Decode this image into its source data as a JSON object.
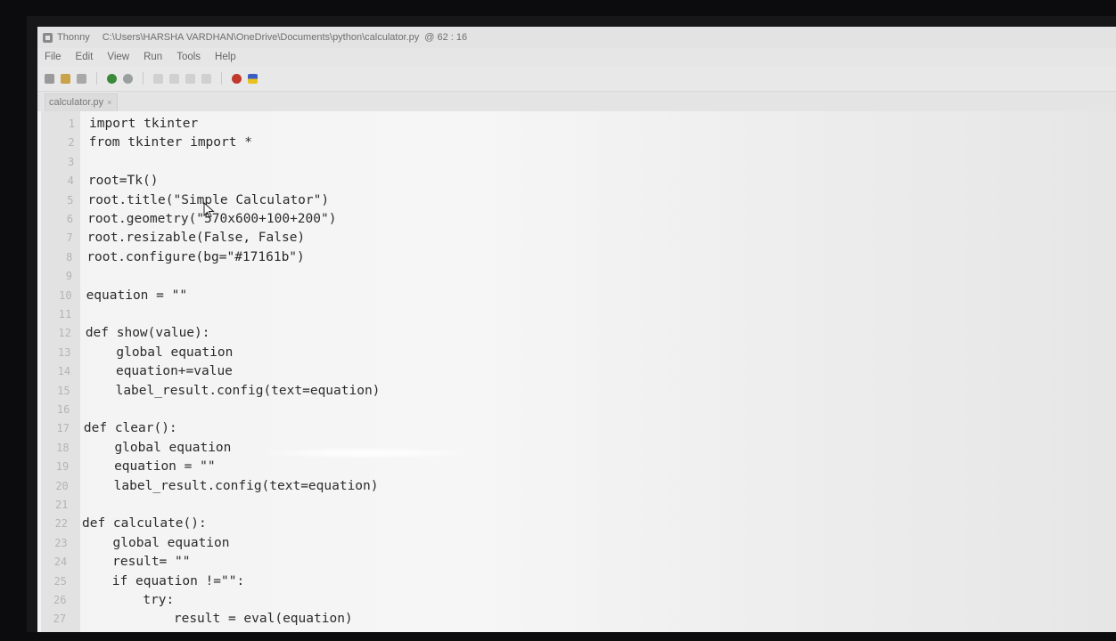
{
  "window": {
    "app_name": "Thonny",
    "file_path": "C:\\Users\\HARSHA VARDHAN\\OneDrive\\Documents\\python\\calculator.py",
    "position": "@ 62 : 16"
  },
  "menu": [
    "File",
    "Edit",
    "View",
    "Run",
    "Tools",
    "Help"
  ],
  "tab": {
    "label": "calculator.py",
    "close": "×"
  },
  "code_lines": [
    {
      "n": "1",
      "text": "import tkinter"
    },
    {
      "n": "2",
      "text": "from tkinter import *"
    },
    {
      "n": "3",
      "text": ""
    },
    {
      "n": "4",
      "text": "root=Tk()"
    },
    {
      "n": "5",
      "text": "root.title(\"Simple Calculator\")"
    },
    {
      "n": "6",
      "text": "root.geometry(\"570x600+100+200\")"
    },
    {
      "n": "7",
      "text": "root.resizable(False, False)"
    },
    {
      "n": "8",
      "text": "root.configure(bg=\"#17161b\")"
    },
    {
      "n": "9",
      "text": ""
    },
    {
      "n": "10",
      "text": "equation = \"\""
    },
    {
      "n": "11",
      "text": ""
    },
    {
      "n": "12",
      "text": "def show(value):"
    },
    {
      "n": "13",
      "text": "    global equation"
    },
    {
      "n": "14",
      "text": "    equation+=value"
    },
    {
      "n": "15",
      "text": "    label_result.config(text=equation)"
    },
    {
      "n": "16",
      "text": ""
    },
    {
      "n": "17",
      "text": "def clear():"
    },
    {
      "n": "18",
      "text": "    global equation"
    },
    {
      "n": "19",
      "text": "    equation = \"\""
    },
    {
      "n": "20",
      "text": "    label_result.config(text=equation)"
    },
    {
      "n": "21",
      "text": ""
    },
    {
      "n": "22",
      "text": "def calculate():"
    },
    {
      "n": "23",
      "text": "    global equation"
    },
    {
      "n": "24",
      "text": "    result= \"\""
    },
    {
      "n": "25",
      "text": "    if equation !=\"\":"
    },
    {
      "n": "26",
      "text": "        try:"
    },
    {
      "n": "27",
      "text": "            result = eval(equation)"
    }
  ],
  "colors": {
    "editor_bg": "#f4f4f4",
    "line_numbers": "#b4b4b4",
    "code_text": "#2b2b2b",
    "stop_button": "#c0392b"
  }
}
